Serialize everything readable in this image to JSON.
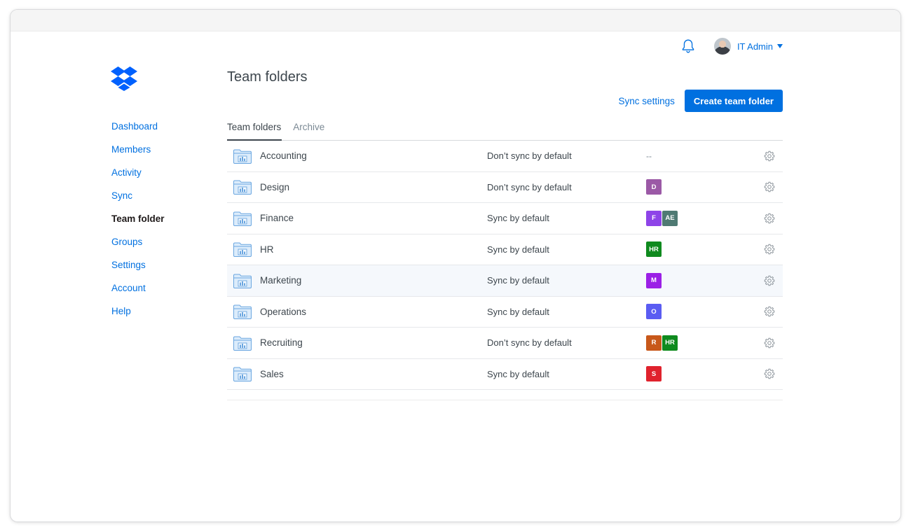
{
  "header": {
    "user_name": "IT Admin"
  },
  "sidebar": {
    "items": [
      {
        "label": "Dashboard",
        "active": false
      },
      {
        "label": "Members",
        "active": false
      },
      {
        "label": "Activity",
        "active": false
      },
      {
        "label": "Sync",
        "active": false
      },
      {
        "label": "Team folder",
        "active": true
      },
      {
        "label": "Groups",
        "active": false
      },
      {
        "label": "Settings",
        "active": false
      },
      {
        "label": "Account",
        "active": false
      },
      {
        "label": "Help",
        "active": false
      }
    ]
  },
  "main": {
    "title": "Team folders",
    "sync_settings_label": "Sync settings",
    "create_button_label": "Create team folder",
    "tabs": [
      {
        "label": "Team folders",
        "active": true
      },
      {
        "label": "Archive",
        "active": false
      }
    ],
    "folders": [
      {
        "name": "Accounting",
        "sync": "Don’t sync by default",
        "groups_empty": "--",
        "groups": []
      },
      {
        "name": "Design",
        "sync": "Don’t sync by default",
        "groups": [
          {
            "label": "D",
            "color": "#9b59a6"
          }
        ]
      },
      {
        "name": "Finance",
        "sync": "Sync by default",
        "groups": [
          {
            "label": "F",
            "color": "#8e44e8"
          },
          {
            "label": "AE",
            "color": "#4f7a73"
          }
        ]
      },
      {
        "name": "HR",
        "sync": "Sync by default",
        "groups": [
          {
            "label": "HR",
            "color": "#0f8a1e"
          }
        ]
      },
      {
        "name": "Marketing",
        "sync": "Sync by default",
        "highlight": true,
        "groups": [
          {
            "label": "M",
            "color": "#9b20e6"
          }
        ]
      },
      {
        "name": "Operations",
        "sync": "Sync by default",
        "groups": [
          {
            "label": "O",
            "color": "#5a5cf2"
          }
        ]
      },
      {
        "name": "Recruiting",
        "sync": "Don’t sync by default",
        "groups": [
          {
            "label": "R",
            "color": "#c8581a"
          },
          {
            "label": "HR",
            "color": "#0f8a1e"
          }
        ]
      },
      {
        "name": "Sales",
        "sync": "Sync by default",
        "groups": [
          {
            "label": "S",
            "color": "#e0222d"
          }
        ]
      }
    ]
  },
  "colors": {
    "accent": "#0070e0",
    "text": "#3d464d",
    "muted": "#7b8994"
  },
  "icons": {
    "logo": "dropbox-logo",
    "notification": "bell-icon",
    "folder": "team-folder-icon",
    "row_action": "gear-icon"
  }
}
